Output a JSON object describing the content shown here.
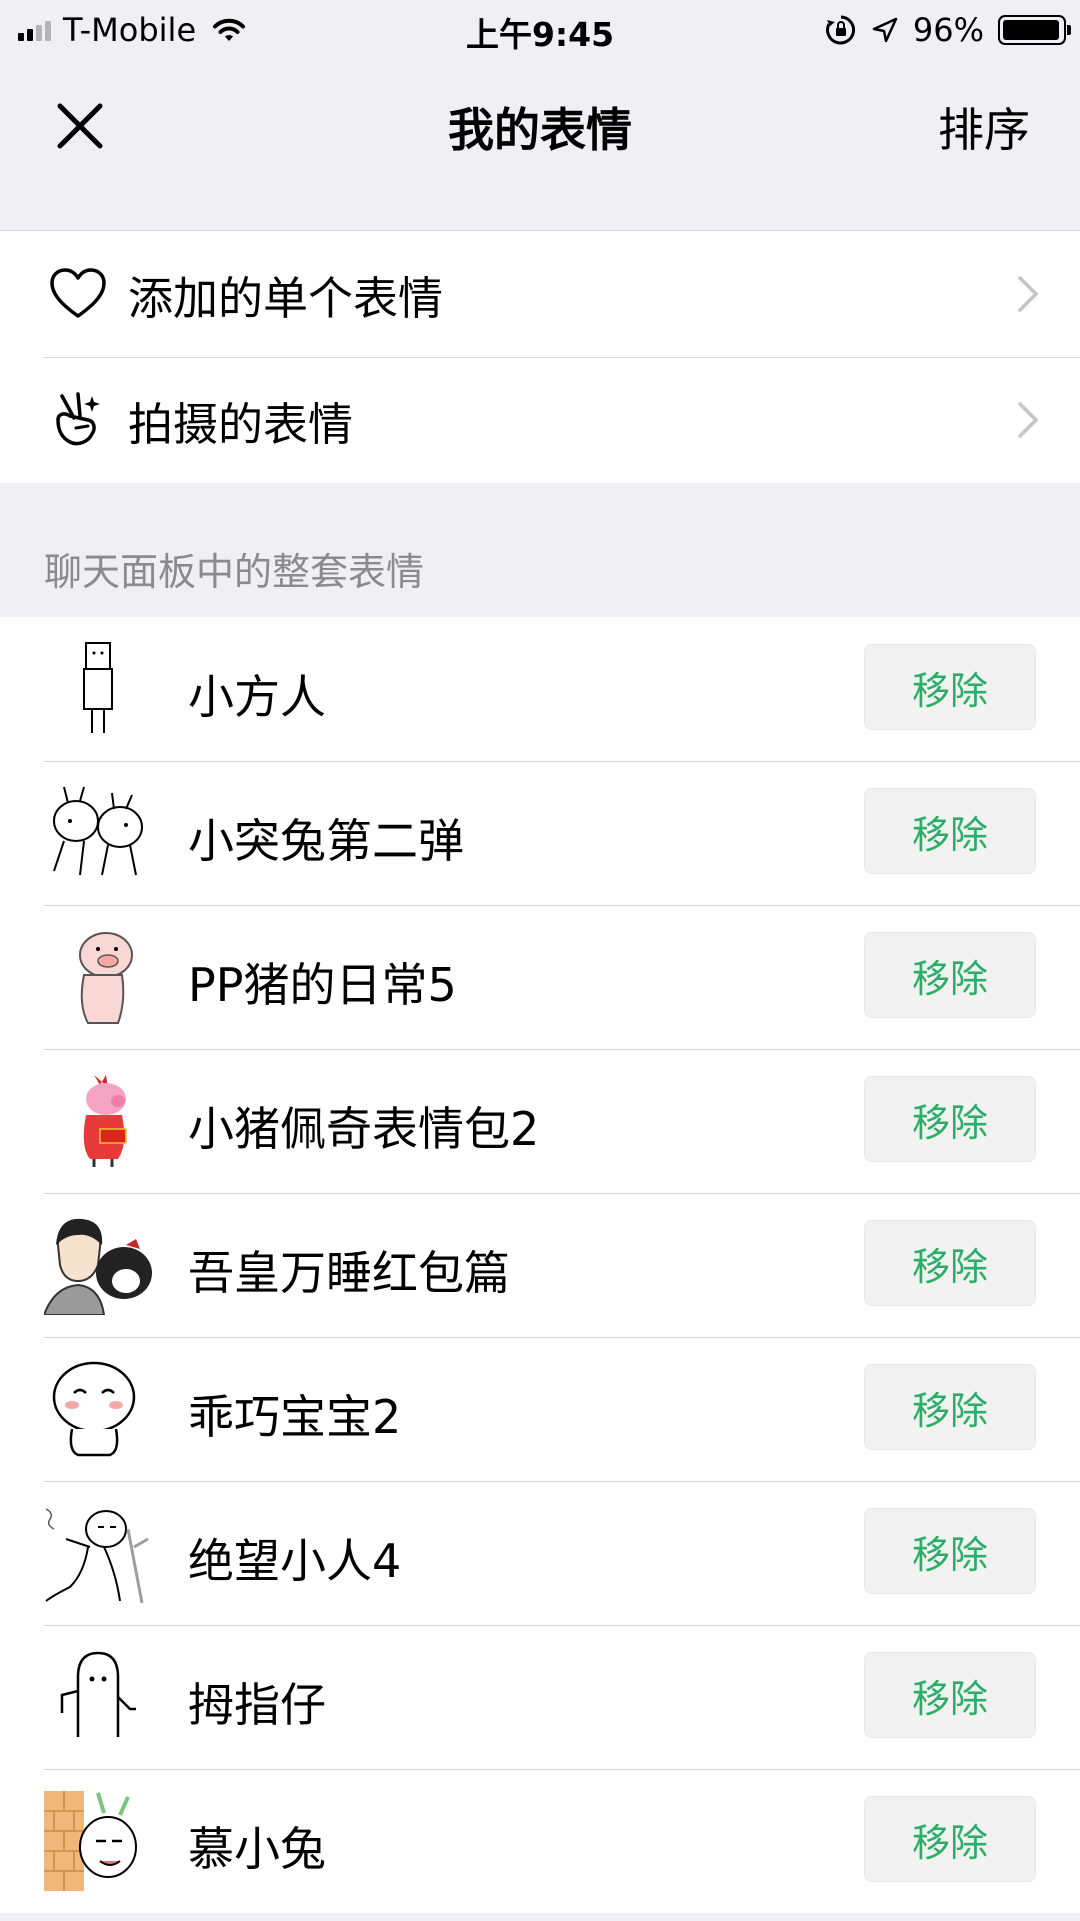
{
  "status_bar": {
    "carrier": "T-Mobile",
    "time": "上午9:45",
    "battery_percent": "96%",
    "battery_level": 0.96
  },
  "nav": {
    "title": "我的表情",
    "sort_label": "排序",
    "close_icon": "close-icon"
  },
  "menu": [
    {
      "label": "添加的单个表情",
      "icon": "heart-icon"
    },
    {
      "label": "拍摄的表情",
      "icon": "hand-gesture-icon"
    }
  ],
  "section_header": "聊天面板中的整套表情",
  "sticker_packs": [
    {
      "name": "小方人",
      "action": "移除"
    },
    {
      "name": "小突兔第二弹",
      "action": "移除"
    },
    {
      "name": "PP猪的日常5",
      "action": "移除"
    },
    {
      "name": "小猪佩奇表情包2",
      "action": "移除"
    },
    {
      "name": "吾皇万睡红包篇",
      "action": "移除"
    },
    {
      "name": "乖巧宝宝2",
      "action": "移除"
    },
    {
      "name": "绝望小人4",
      "action": "移除"
    },
    {
      "name": "拇指仔",
      "action": "移除"
    },
    {
      "name": "慕小兔",
      "action": "移除"
    }
  ],
  "colors": {
    "accent_green": "#2aae67",
    "background": "#efeff4",
    "secondary_text": "#8a8a8f"
  }
}
